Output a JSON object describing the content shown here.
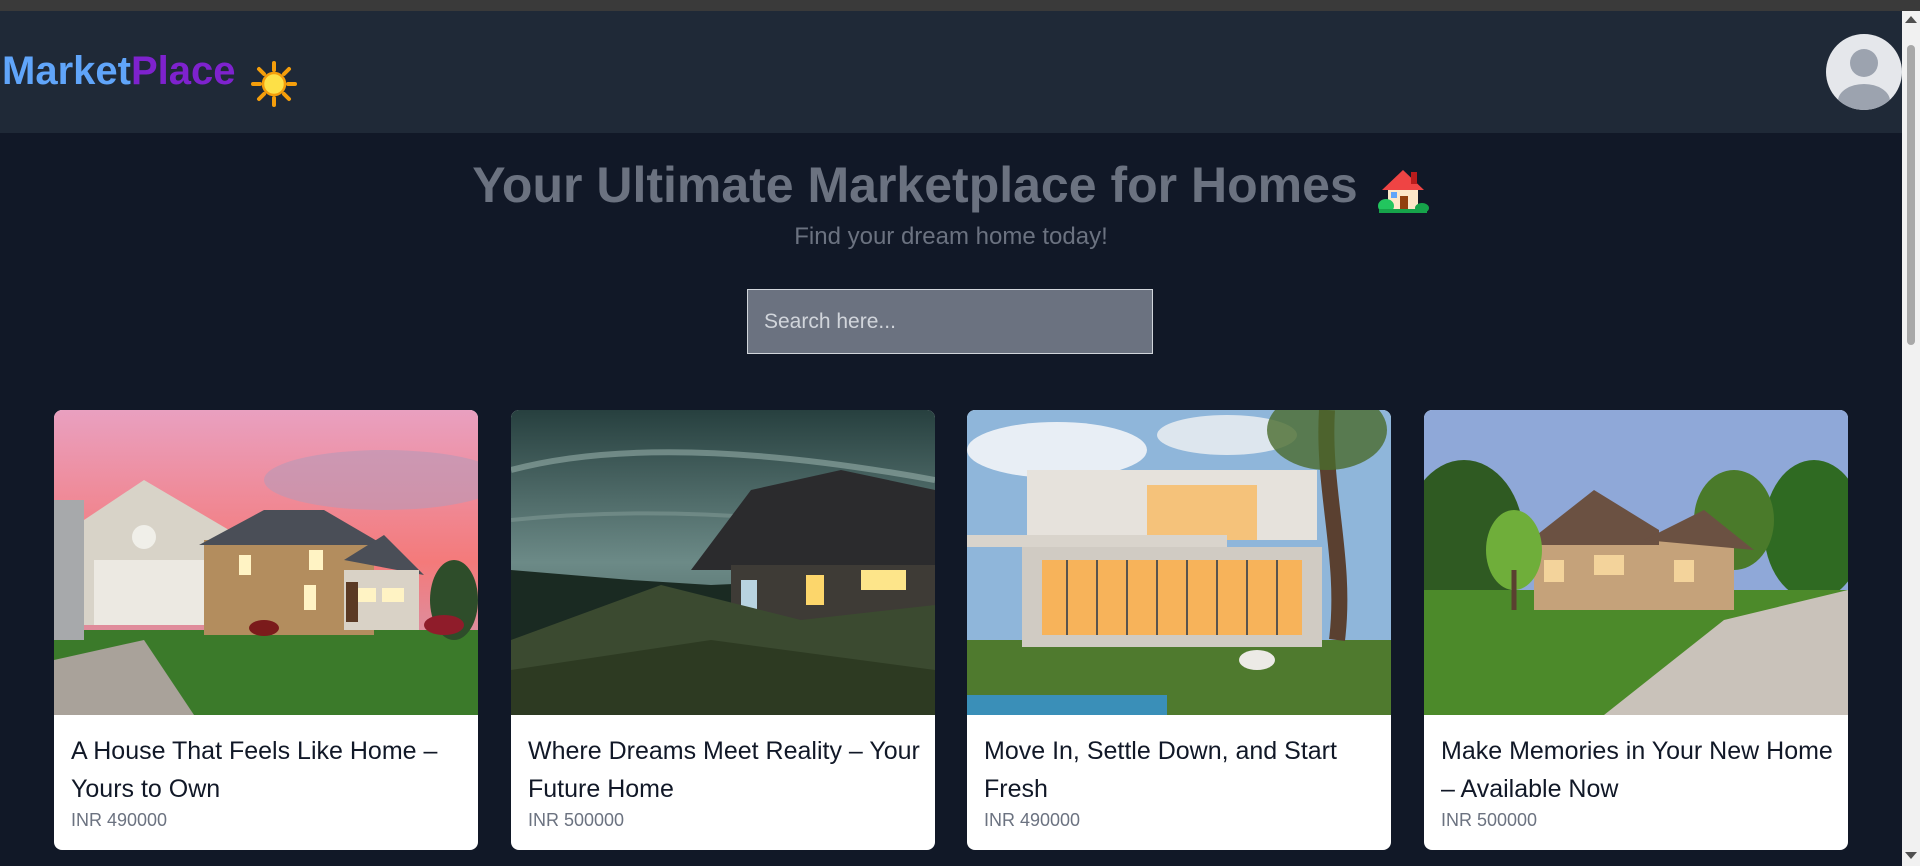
{
  "brand": {
    "part1": "Market",
    "part2": "Place",
    "theme_icon": "sun-icon"
  },
  "user": {
    "avatar_icon": "user-avatar-icon"
  },
  "hero": {
    "title": "Your Ultimate Marketplace for Homes",
    "title_icon": "house-icon",
    "subtitle": "Find your dream home today!"
  },
  "search": {
    "placeholder": "Search here...",
    "value": ""
  },
  "listings": [
    {
      "title": "A House That Feels Like Home – Yours to Own",
      "price": "INR 490000",
      "image": "suburban-house-sunset"
    },
    {
      "title": "Where Dreams Meet Reality – Your Future Home",
      "price": "INR 500000",
      "image": "thatched-cottage-night"
    },
    {
      "title": "Move In, Settle Down, and Start Fresh",
      "price": "INR 490000",
      "image": "modern-villa"
    },
    {
      "title": "Make Memories in Your New Home – Available Now",
      "price": "INR 500000",
      "image": "stone-house-driveway"
    }
  ],
  "colors": {
    "background": "#111827",
    "navbar": "#1f2937",
    "brand_blue": "#60a5fa",
    "brand_purple": "#7e22ce",
    "muted_text": "#6b7280"
  }
}
